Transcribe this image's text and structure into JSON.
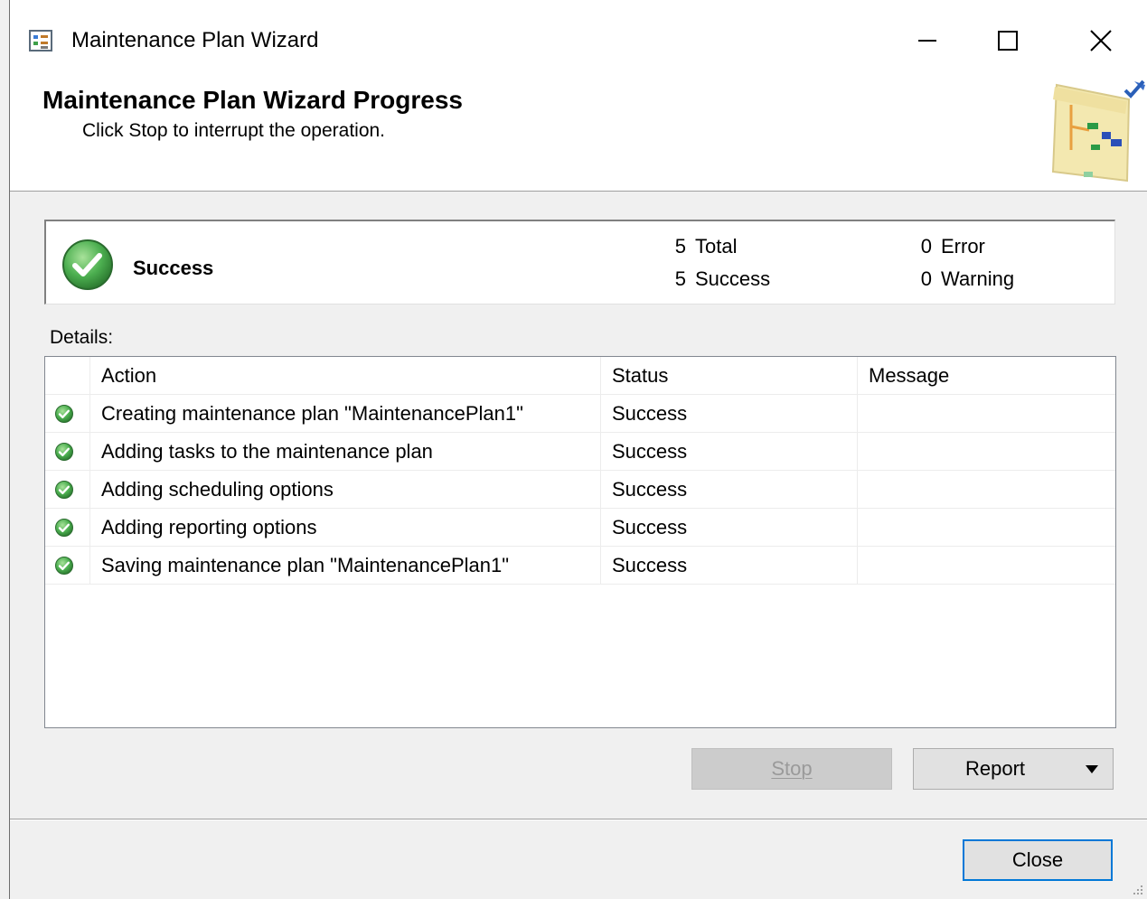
{
  "window": {
    "title": "Maintenance Plan Wizard"
  },
  "header": {
    "title": "Maintenance Plan Wizard Progress",
    "subtitle": "Click Stop to interrupt the operation."
  },
  "summary": {
    "status": "Success",
    "total_count": "5",
    "total_label": "Total",
    "success_count": "5",
    "success_label": "Success",
    "error_count": "0",
    "error_label": "Error",
    "warning_count": "0",
    "warning_label": "Warning"
  },
  "details": {
    "label": "Details:",
    "columns": [
      "Action",
      "Status",
      "Message"
    ],
    "rows": [
      {
        "action": "Creating maintenance plan \"MaintenancePlan1\"",
        "status": "Success",
        "message": ""
      },
      {
        "action": "Adding tasks to the maintenance plan",
        "status": "Success",
        "message": ""
      },
      {
        "action": "Adding scheduling options",
        "status": "Success",
        "message": ""
      },
      {
        "action": "Adding reporting options",
        "status": "Success",
        "message": ""
      },
      {
        "action": "Saving maintenance plan \"MaintenancePlan1\"",
        "status": "Success",
        "message": ""
      }
    ]
  },
  "buttons": {
    "stop": "Stop",
    "report": "Report",
    "close": "Close"
  },
  "colors": {
    "success_green": "#4caf50",
    "focus_blue": "#0078d7"
  },
  "icons": {
    "app": "maintenance-plan-icon",
    "status": "success-check-icon",
    "row": "success-check-icon"
  }
}
